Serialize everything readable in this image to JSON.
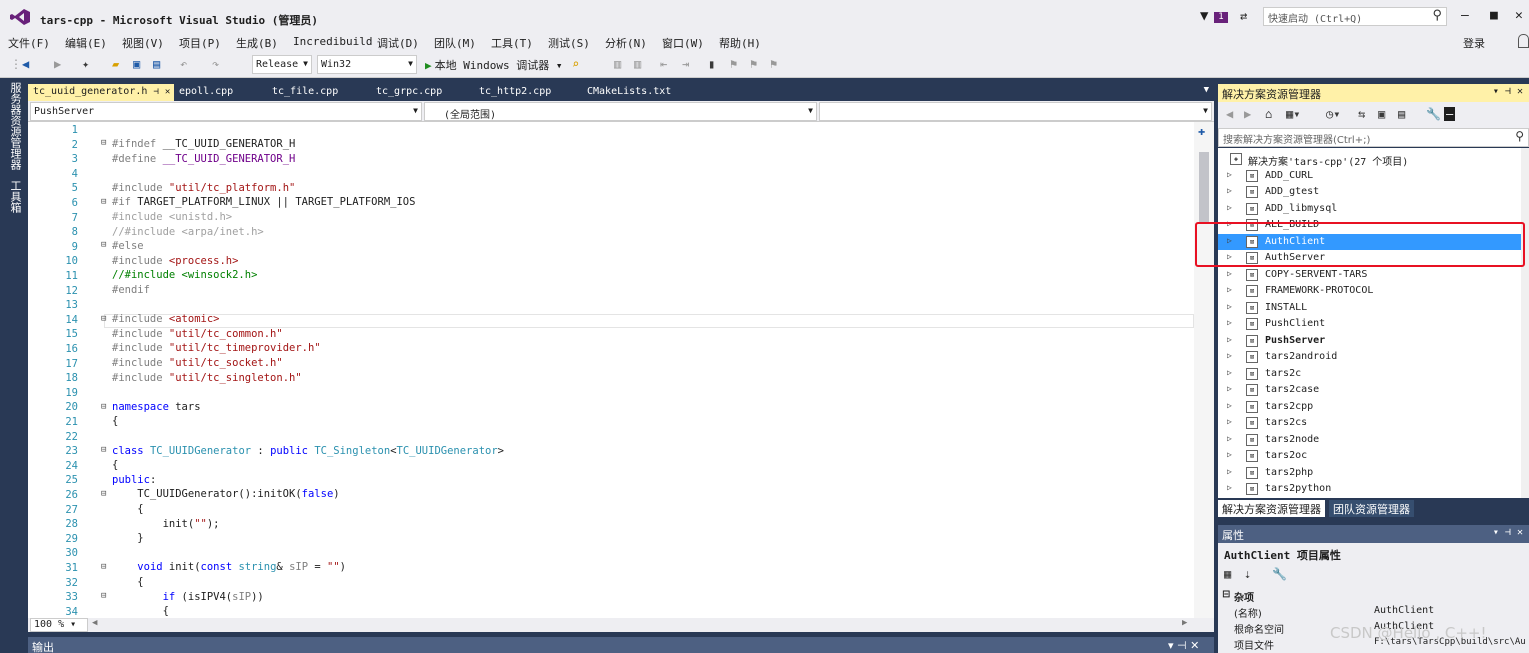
{
  "window": {
    "title": "tars-cpp - Microsoft Visual Studio (管理员)",
    "notification_count": "1",
    "quick_launch_placeholder": "快速启动 (Ctrl+Q)",
    "login": "登录"
  },
  "menu": [
    "文件(F)",
    "编辑(E)",
    "视图(V)",
    "项目(P)",
    "生成(B)",
    "Incredibuild",
    "调试(D)",
    "团队(M)",
    "工具(T)",
    "测试(S)",
    "分析(N)",
    "窗口(W)",
    "帮助(H)"
  ],
  "toolbar": {
    "configuration": "Release",
    "platform": "Win32",
    "run_label": "本地 Windows 调试器"
  },
  "left_strip": [
    "服务器资源管理器",
    "工具箱"
  ],
  "doc_tabs": [
    "tc_uuid_generator.h",
    "epoll.cpp",
    "tc_file.cpp",
    "tc_grpc.cpp",
    "tc_http2.cpp",
    "CMakeLists.txt"
  ],
  "nav": {
    "project": "PushServer",
    "scope": "(全局范围)"
  },
  "code": {
    "line_numbers": [
      "1",
      "2",
      "3",
      "4",
      "5",
      "6",
      "7",
      "8",
      "9",
      "10",
      "11",
      "12",
      "13",
      "14",
      "15",
      "16",
      "17",
      "18",
      "19",
      "20",
      "21",
      "22",
      "23",
      "24",
      "25",
      "26",
      "27",
      "28",
      "29",
      "30",
      "31",
      "32",
      "33",
      "34"
    ],
    "zoom": "100 %"
  },
  "output_title": "输出",
  "solution_explorer": {
    "title": "解决方案资源管理器",
    "search_placeholder": "搜索解决方案资源管理器(Ctrl+;)",
    "root": "解决方案'tars-cpp'(27 个项目)",
    "items": [
      "ADD_CURL",
      "ADD_gtest",
      "ADD_libmysql",
      "ALL_BUILD",
      "AuthClient",
      "AuthServer",
      "COPY-SERVENT-TARS",
      "FRAMEWORK-PROTOCOL",
      "INSTALL",
      "PushClient",
      "PushServer",
      "tars2android",
      "tars2c",
      "tars2case",
      "tars2cpp",
      "tars2cs",
      "tars2node",
      "tars2oc",
      "tars2php",
      "tars2python"
    ],
    "selected": "AuthClient",
    "bold": "PushServer",
    "tab_active": "解决方案资源管理器",
    "tab_inactive": "团队资源管理器"
  },
  "properties": {
    "title": "属性",
    "object": "AuthClient 项目属性",
    "category": "杂项",
    "rows": [
      {
        "key": "(名称)",
        "value": "AuthClient"
      },
      {
        "key": "根命名空间",
        "value": "AuthClient"
      },
      {
        "key": "项目文件",
        "value": "F:\\tars\\TarsCpp\\build\\src\\Au"
      }
    ]
  },
  "watermark": "CSDN @Hello , C++!"
}
